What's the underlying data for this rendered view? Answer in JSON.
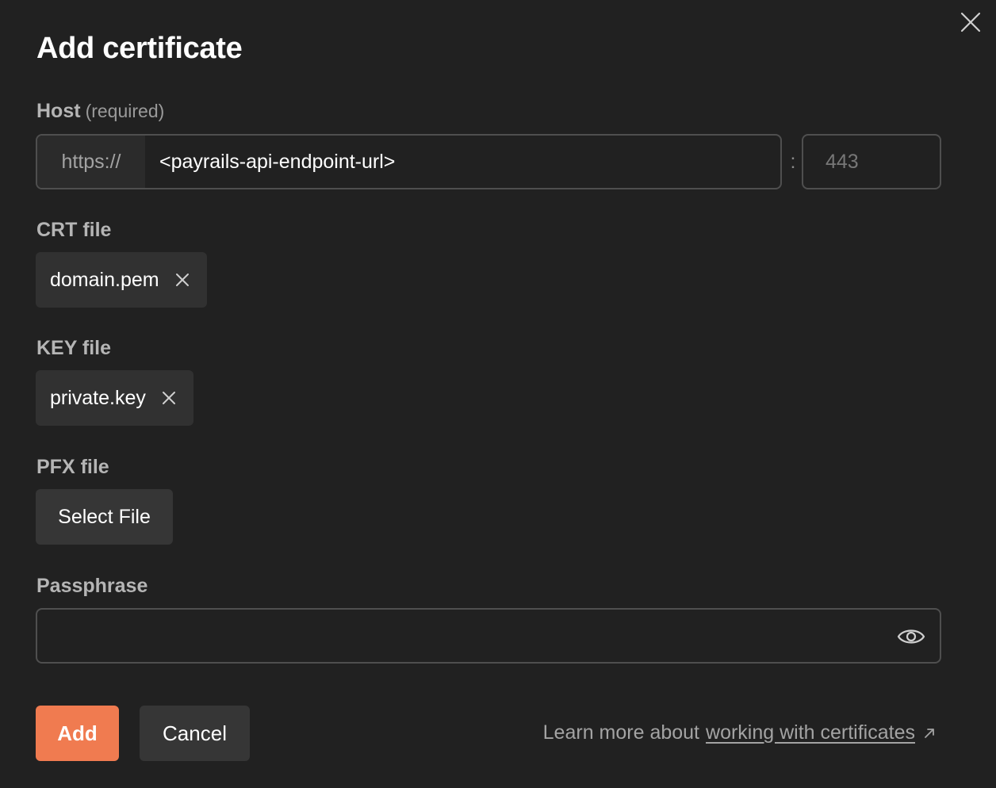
{
  "dialog": {
    "title": "Add certificate",
    "close_icon": "close-icon"
  },
  "host": {
    "label": "Host",
    "hint": "(required)",
    "prefix": "https://",
    "value": "<payrails-api-endpoint-url>",
    "separator": ":",
    "port_placeholder": "443"
  },
  "crt": {
    "label": "CRT file",
    "file_name": "domain.pem",
    "remove_icon": "close-icon"
  },
  "key": {
    "label": "KEY file",
    "file_name": "private.key",
    "remove_icon": "close-icon"
  },
  "pfx": {
    "label": "PFX file",
    "select_label": "Select File"
  },
  "passphrase": {
    "label": "Passphrase",
    "value": "",
    "toggle_icon": "eye-icon"
  },
  "footer": {
    "add_label": "Add",
    "cancel_label": "Cancel",
    "learn_prefix": "Learn more about",
    "learn_link": "working with certificates",
    "link_icon": "external-link-icon"
  },
  "colors": {
    "background": "#212121",
    "accent": "#f07b50",
    "border": "#4f4f4f",
    "chip": "#313131"
  }
}
